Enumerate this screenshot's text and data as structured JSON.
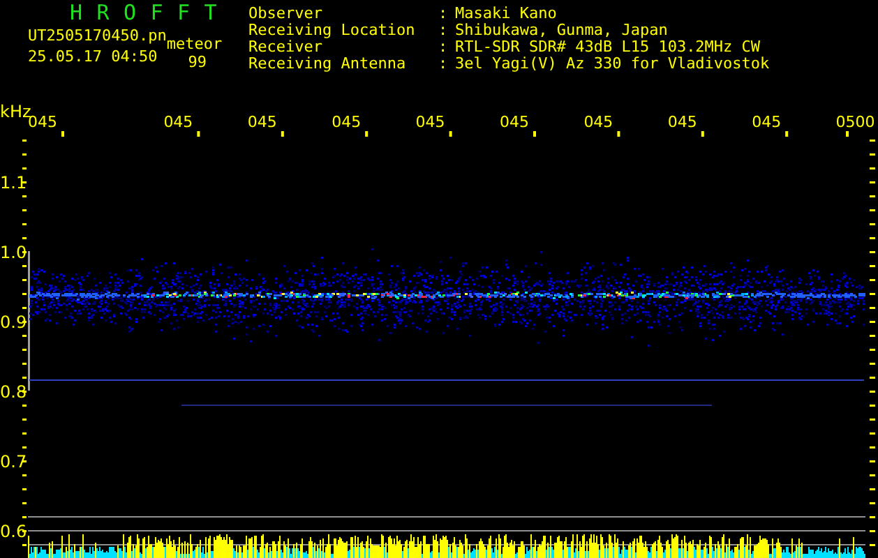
{
  "title": "H R O F F T",
  "file": {
    "name": "UT2505170450.pn",
    "type": "meteor"
  },
  "timestamp": "25.05.17 04:50",
  "count": "99",
  "info": [
    {
      "label": "Observer",
      "separator": ":",
      "value": "Masaki Kano"
    },
    {
      "label": "Receiving Location",
      "separator": ":",
      "value": "Shibukawa, Gunma, Japan"
    },
    {
      "label": "Receiver",
      "separator": ":",
      "value": "RTL-SDR SDR# 43dB L15 103.2MHz CW"
    },
    {
      "label": "Receiving Antenna",
      "separator": ":",
      "value": "3el Yagi(V) Az 330 for Vladivostok"
    }
  ],
  "axis": {
    "unit": "kHz",
    "y_labels": [
      "1.1",
      "1.0",
      "0.9",
      "0.8",
      "0.7",
      "0.6"
    ],
    "time_labels": [
      "045",
      "045",
      "045",
      "045",
      "045",
      "045",
      "045",
      "045",
      "045",
      "0500"
    ]
  }
}
